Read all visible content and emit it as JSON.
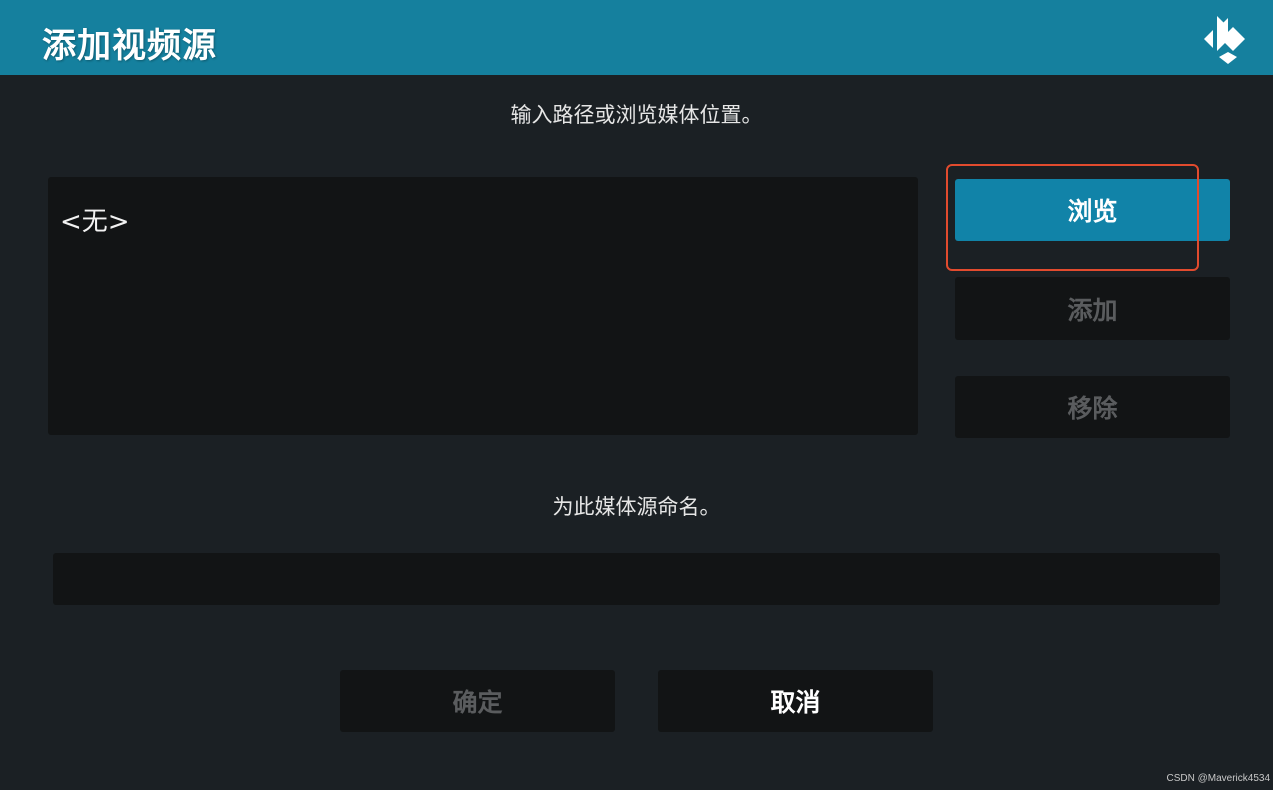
{
  "header": {
    "title": "添加视频源",
    "logo_icon": "kodi-logo-icon"
  },
  "path_section": {
    "prompt": "输入路径或浏览媒体位置。",
    "items": [
      "<无>"
    ]
  },
  "side_buttons": {
    "browse_label": "浏览",
    "add_label": "添加",
    "remove_label": "移除"
  },
  "name_section": {
    "prompt": "为此媒体源命名。",
    "value": ""
  },
  "footer_buttons": {
    "ok_label": "确定",
    "cancel_label": "取消"
  },
  "watermark": "CSDN @Maverick4534",
  "colors": {
    "header_bg": "#15809e",
    "body_bg": "#1b2024",
    "panel_bg": "#121415",
    "accent": "#1183a8",
    "highlight": "#e24b2e",
    "disabled_text": "#5a5c5e"
  }
}
